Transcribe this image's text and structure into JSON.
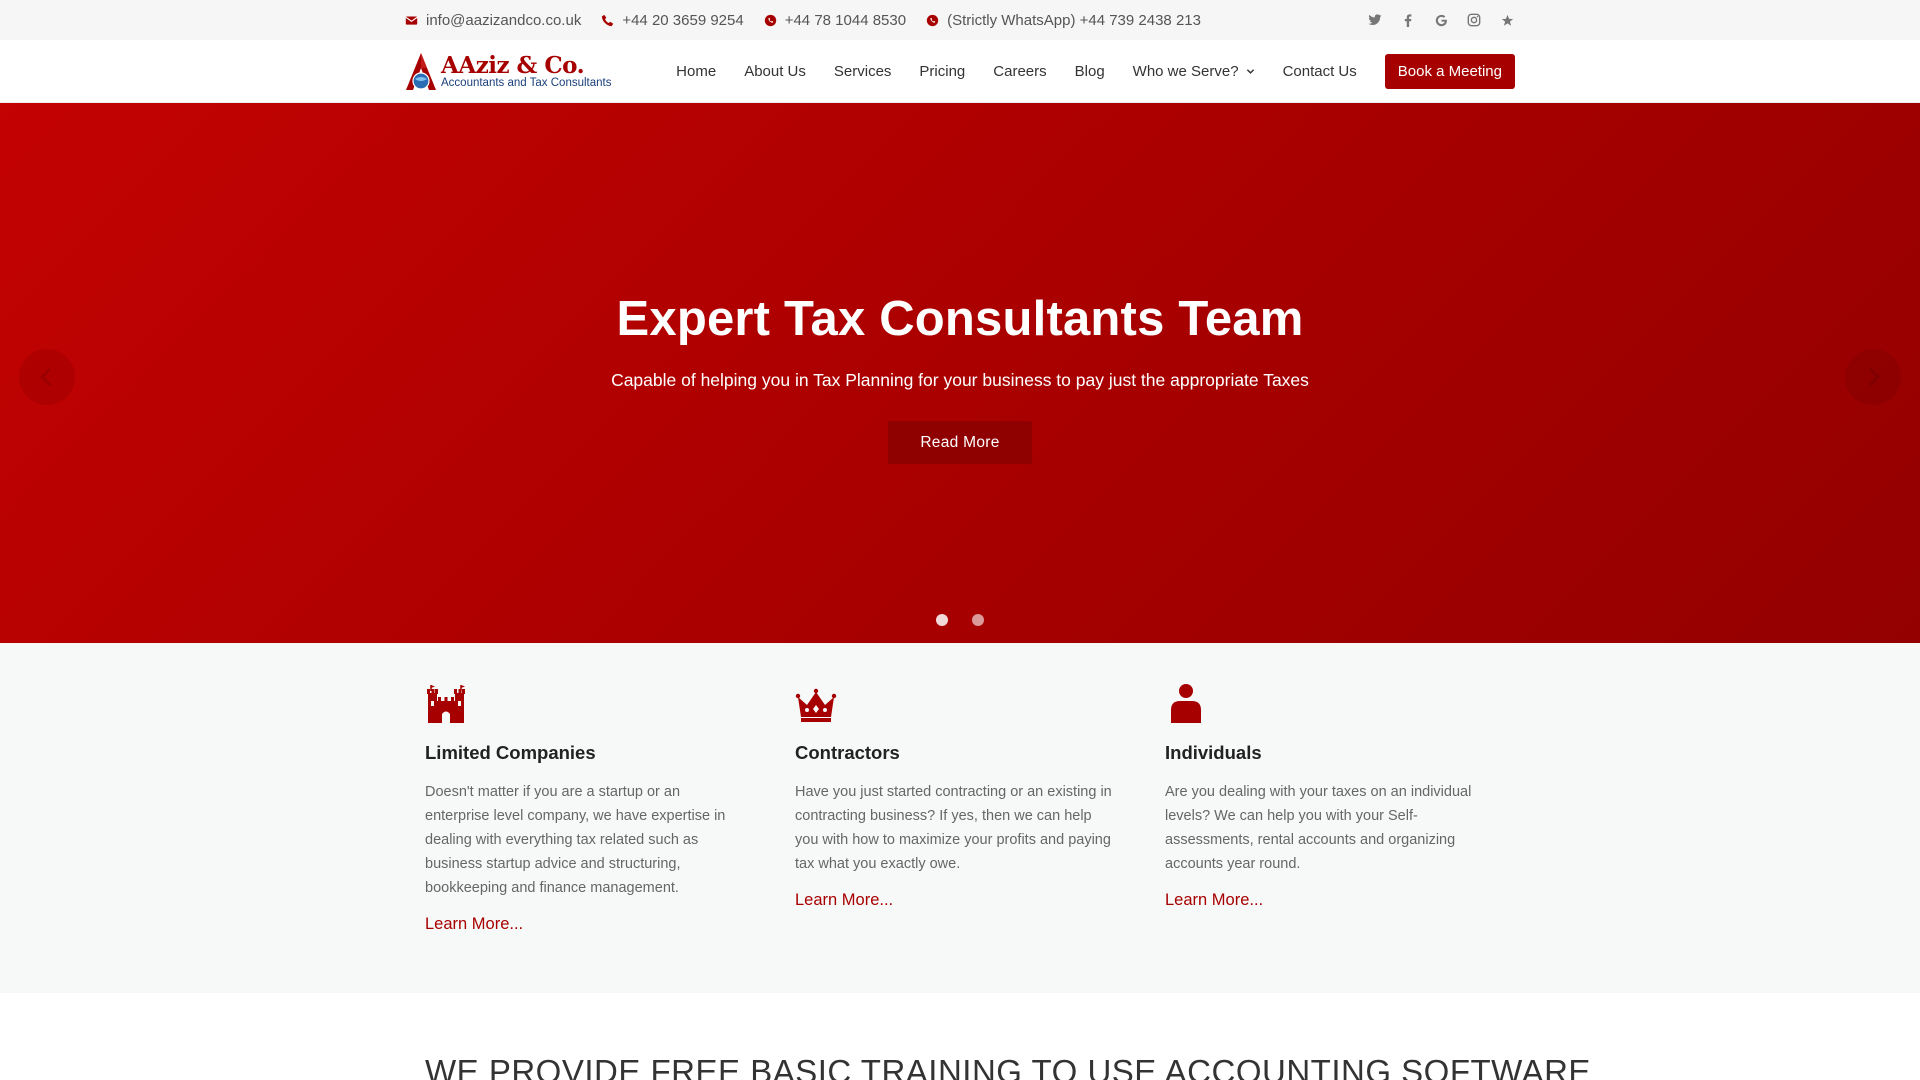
{
  "topbar": {
    "email": "info@aazizandco.co.uk",
    "phone": "+44 20 3659 9254",
    "mobile": "+44 78 1044 8530",
    "whatsapp": "(Strictly WhatsApp) +44 739 2438 213",
    "socials": [
      "twitter-icon",
      "facebook-icon",
      "google-icon",
      "instagram-icon",
      "star-icon"
    ]
  },
  "header": {
    "logo_name": "AAziz & Co.",
    "logo_sub": "Accountants and Tax Consultants",
    "nav": [
      "Home",
      "About Us",
      "Services",
      "Pricing",
      "Careers",
      "Blog",
      "Who we Serve?",
      "Contact Us"
    ],
    "cta": "Book a Meeting"
  },
  "hero": {
    "title": "Expert Tax Consultants Team",
    "subtitle": "Capable of helping you in Tax Planning for your business to pay just the appropriate Taxes",
    "button": "Read More",
    "slides": 2,
    "active_slide": 1
  },
  "features": [
    {
      "icon": "castle-icon",
      "title": "Limited Companies",
      "text": "Doesn't matter if you are a startup or an enterprise level company, we have expertise in dealing with everything tax related such as business startup advice and structuring, bookkeeping and finance management.",
      "link": "Learn More..."
    },
    {
      "icon": "crown-icon",
      "title": "Contractors",
      "text": "Have you just started contracting or an existing in contracting business? If yes, then we can help you with how to maximize your profits and paying tax what you exactly owe.",
      "link": "Learn More..."
    },
    {
      "icon": "user-icon",
      "title": "Individuals",
      "text": "Are you dealing with your taxes on an individual levels? We can help you with your Self-assessments, rental accounts and organizing accounts year round.",
      "link": "Learn More..."
    }
  ],
  "training": {
    "heading": "WE PROVIDE FREE BASIC TRAINING TO USE ACCOUNTING SOFTWARE"
  },
  "colors": {
    "brand": "#a70000",
    "hero_start": "#c30202",
    "hero_end": "#940000"
  }
}
